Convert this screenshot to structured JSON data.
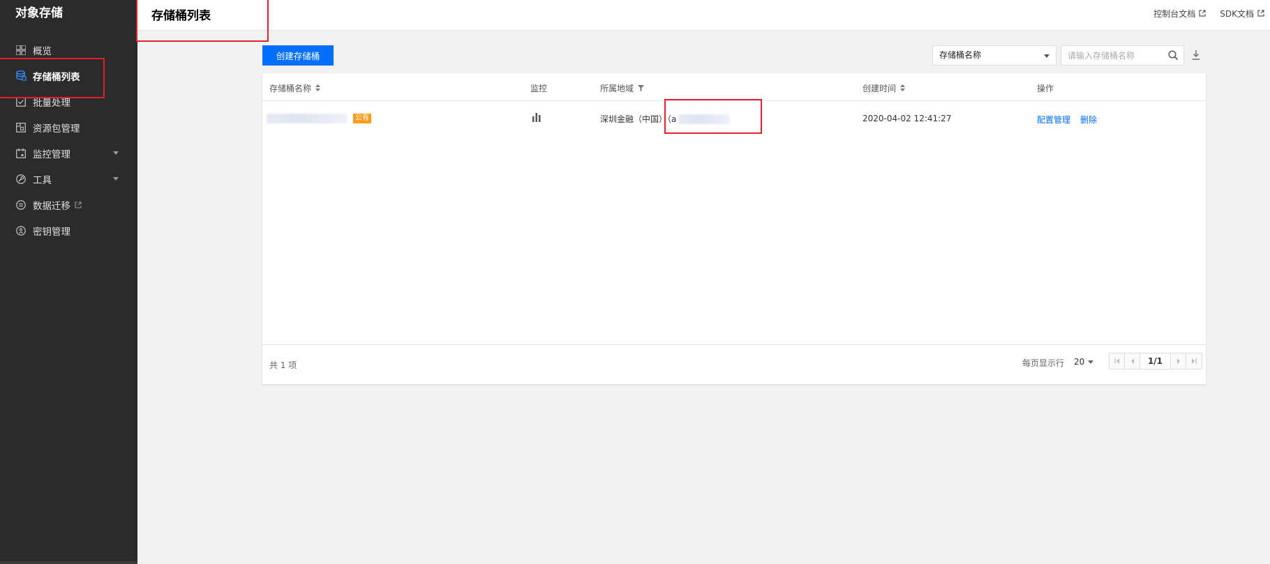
{
  "sidebar": {
    "title": "对象存储",
    "items": [
      {
        "label": "概览",
        "icon": "grid-icon"
      },
      {
        "label": "存储桶列表",
        "icon": "database-icon",
        "active": true
      },
      {
        "label": "批量处理",
        "icon": "checkbox-icon"
      },
      {
        "label": "资源包管理",
        "icon": "package-icon"
      },
      {
        "label": "监控管理",
        "icon": "calendar-icon",
        "expandable": true
      },
      {
        "label": "工具",
        "icon": "tool-icon",
        "expandable": true
      },
      {
        "label": "数据迁移",
        "icon": "migrate-icon",
        "external": true
      },
      {
        "label": "密钥管理",
        "icon": "key-icon"
      }
    ]
  },
  "header": {
    "title": "存储桶列表",
    "links": [
      {
        "label": "控制台文档",
        "icon": "external-link-icon"
      },
      {
        "label": "SDK文档",
        "icon": "external-link-icon"
      }
    ]
  },
  "toolbar": {
    "create_label": "创建存储桶",
    "filter_select": "存储桶名称",
    "search_placeholder": "请输入存储桶名称"
  },
  "table": {
    "columns": [
      "存储桶名称",
      "监控",
      "所属地域",
      "创建时间",
      "操作"
    ],
    "rows": [
      {
        "name_tag": "公有",
        "region_prefix": "深圳金融（中国）（a",
        "created": "2020-04-02 12:41:27",
        "actions": [
          "配置管理",
          "删除"
        ]
      }
    ]
  },
  "footer": {
    "total": "共 1 项",
    "per_page_label": "每页显示行",
    "per_page_value": "20",
    "page_indicator": "1/1"
  },
  "colors": {
    "sidebar_bg": "#2b2b2b",
    "primary": "#006eff",
    "public_tag": "#ff9c19",
    "annotation": "#e0202a"
  }
}
